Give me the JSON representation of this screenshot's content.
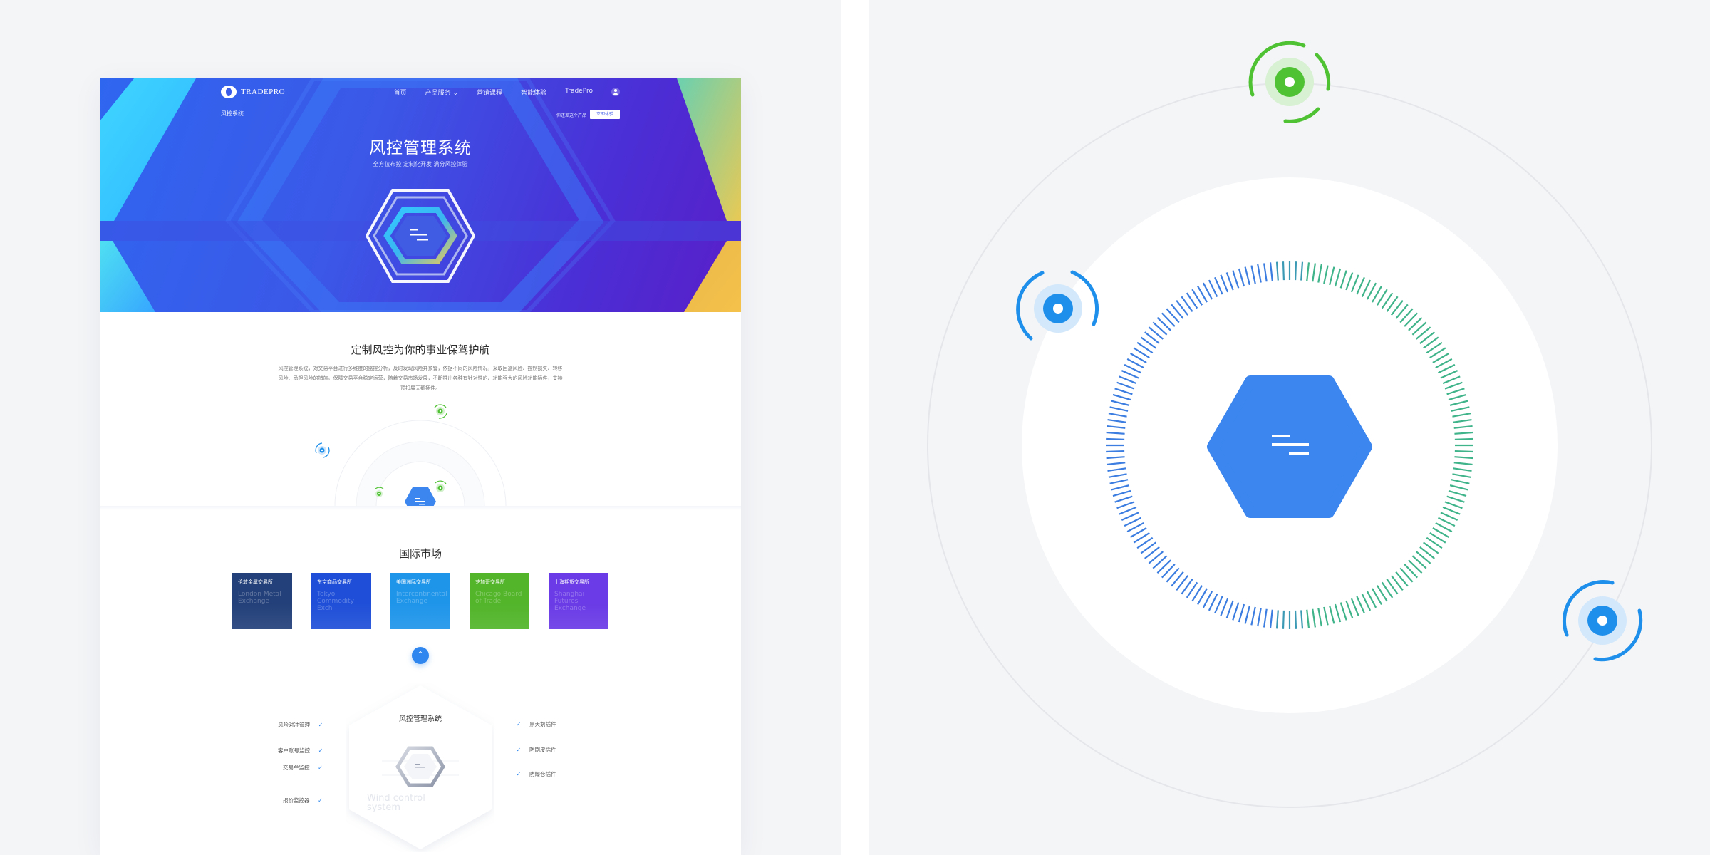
{
  "nav": {
    "logo_text": "TRADEPRO",
    "items": [
      "首页",
      "产品服务",
      "营销课程",
      "智能体验",
      "TradePro"
    ]
  },
  "subnav": {
    "title": "风控系统",
    "trial_text": "你还差这个产品",
    "trial_button": "立即体验"
  },
  "hero": {
    "title": "风控管理系统",
    "subtitle": "全方位布控   定制化开发   满分风控体验"
  },
  "section_intro": {
    "title": "定制风控为你的事业保驾护航",
    "description": "风控管理系统，对交易平台进行多维度的监控分析，及时发现风险并预警，依据不同的风险情况，采取回避风险、控制损失、转移风险、承担风险的措施。保障交易平台稳定运营，随着交易市场发展，不断推出各种有针对性的、功能强大的风险功能插件，支持预扣展天鹅插件。"
  },
  "markets": {
    "title": "国际市场",
    "cards": [
      {
        "name": "伦敦金属交易所",
        "en": "London Metal Exchange",
        "color": "#23407a"
      },
      {
        "name": "东京商品交易所",
        "en": "Tokyo Commodity Exch",
        "color": "#1f4fd8"
      },
      {
        "name": "美国洲际交易所",
        "en": "Intercontinental Exchange",
        "color": "#1f95ea"
      },
      {
        "name": "芝加哥交易所",
        "en": "Chicago Board of Trade",
        "color": "#52b52a"
      },
      {
        "name": "上海期货交易所",
        "en": "Shanghai Futures Exchange",
        "color": "#6a3be6"
      }
    ],
    "scroll_icon": "arrow-up-icon"
  },
  "features": {
    "title": "风控管理系统",
    "english_caption": "Wind control system",
    "left": [
      "风险对冲管理",
      "客户账号监控",
      "交易单监控",
      "报价监控器"
    ],
    "right": [
      "黑天鹅插件",
      "防刷皮插件",
      "防爆仓插件"
    ]
  },
  "colors": {
    "primary": "#2e86ee",
    "hero_start": "#2f66f0",
    "hero_end": "#5a1ec8",
    "green_node": "#4fc234",
    "blue_node": "#1e8fea",
    "ring_green": "#3fb38a",
    "ring_blue": "#3b7de0"
  }
}
